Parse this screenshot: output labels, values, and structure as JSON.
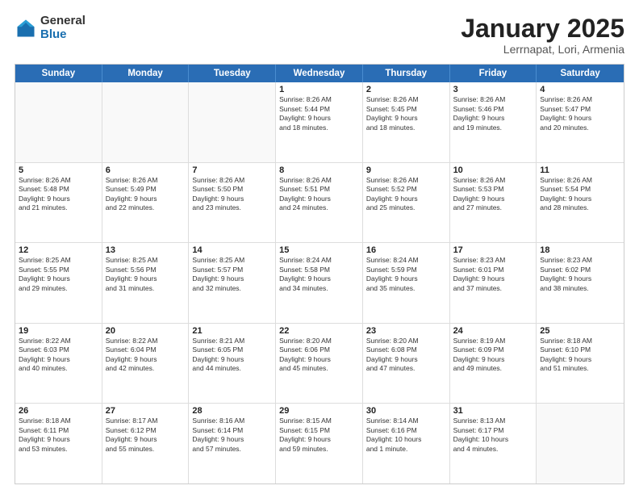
{
  "logo": {
    "general": "General",
    "blue": "Blue"
  },
  "title": "January 2025",
  "subtitle": "Lerrnapat, Lori, Armenia",
  "header_days": [
    "Sunday",
    "Monday",
    "Tuesday",
    "Wednesday",
    "Thursday",
    "Friday",
    "Saturday"
  ],
  "weeks": [
    [
      {
        "day": "",
        "info": "",
        "empty": true
      },
      {
        "day": "",
        "info": "",
        "empty": true
      },
      {
        "day": "",
        "info": "",
        "empty": true
      },
      {
        "day": "1",
        "info": "Sunrise: 8:26 AM\nSunset: 5:44 PM\nDaylight: 9 hours\nand 18 minutes.",
        "empty": false
      },
      {
        "day": "2",
        "info": "Sunrise: 8:26 AM\nSunset: 5:45 PM\nDaylight: 9 hours\nand 18 minutes.",
        "empty": false
      },
      {
        "day": "3",
        "info": "Sunrise: 8:26 AM\nSunset: 5:46 PM\nDaylight: 9 hours\nand 19 minutes.",
        "empty": false
      },
      {
        "day": "4",
        "info": "Sunrise: 8:26 AM\nSunset: 5:47 PM\nDaylight: 9 hours\nand 20 minutes.",
        "empty": false
      }
    ],
    [
      {
        "day": "5",
        "info": "Sunrise: 8:26 AM\nSunset: 5:48 PM\nDaylight: 9 hours\nand 21 minutes.",
        "empty": false
      },
      {
        "day": "6",
        "info": "Sunrise: 8:26 AM\nSunset: 5:49 PM\nDaylight: 9 hours\nand 22 minutes.",
        "empty": false
      },
      {
        "day": "7",
        "info": "Sunrise: 8:26 AM\nSunset: 5:50 PM\nDaylight: 9 hours\nand 23 minutes.",
        "empty": false
      },
      {
        "day": "8",
        "info": "Sunrise: 8:26 AM\nSunset: 5:51 PM\nDaylight: 9 hours\nand 24 minutes.",
        "empty": false
      },
      {
        "day": "9",
        "info": "Sunrise: 8:26 AM\nSunset: 5:52 PM\nDaylight: 9 hours\nand 25 minutes.",
        "empty": false
      },
      {
        "day": "10",
        "info": "Sunrise: 8:26 AM\nSunset: 5:53 PM\nDaylight: 9 hours\nand 27 minutes.",
        "empty": false
      },
      {
        "day": "11",
        "info": "Sunrise: 8:26 AM\nSunset: 5:54 PM\nDaylight: 9 hours\nand 28 minutes.",
        "empty": false
      }
    ],
    [
      {
        "day": "12",
        "info": "Sunrise: 8:25 AM\nSunset: 5:55 PM\nDaylight: 9 hours\nand 29 minutes.",
        "empty": false
      },
      {
        "day": "13",
        "info": "Sunrise: 8:25 AM\nSunset: 5:56 PM\nDaylight: 9 hours\nand 31 minutes.",
        "empty": false
      },
      {
        "day": "14",
        "info": "Sunrise: 8:25 AM\nSunset: 5:57 PM\nDaylight: 9 hours\nand 32 minutes.",
        "empty": false
      },
      {
        "day": "15",
        "info": "Sunrise: 8:24 AM\nSunset: 5:58 PM\nDaylight: 9 hours\nand 34 minutes.",
        "empty": false
      },
      {
        "day": "16",
        "info": "Sunrise: 8:24 AM\nSunset: 5:59 PM\nDaylight: 9 hours\nand 35 minutes.",
        "empty": false
      },
      {
        "day": "17",
        "info": "Sunrise: 8:23 AM\nSunset: 6:01 PM\nDaylight: 9 hours\nand 37 minutes.",
        "empty": false
      },
      {
        "day": "18",
        "info": "Sunrise: 8:23 AM\nSunset: 6:02 PM\nDaylight: 9 hours\nand 38 minutes.",
        "empty": false
      }
    ],
    [
      {
        "day": "19",
        "info": "Sunrise: 8:22 AM\nSunset: 6:03 PM\nDaylight: 9 hours\nand 40 minutes.",
        "empty": false
      },
      {
        "day": "20",
        "info": "Sunrise: 8:22 AM\nSunset: 6:04 PM\nDaylight: 9 hours\nand 42 minutes.",
        "empty": false
      },
      {
        "day": "21",
        "info": "Sunrise: 8:21 AM\nSunset: 6:05 PM\nDaylight: 9 hours\nand 44 minutes.",
        "empty": false
      },
      {
        "day": "22",
        "info": "Sunrise: 8:20 AM\nSunset: 6:06 PM\nDaylight: 9 hours\nand 45 minutes.",
        "empty": false
      },
      {
        "day": "23",
        "info": "Sunrise: 8:20 AM\nSunset: 6:08 PM\nDaylight: 9 hours\nand 47 minutes.",
        "empty": false
      },
      {
        "day": "24",
        "info": "Sunrise: 8:19 AM\nSunset: 6:09 PM\nDaylight: 9 hours\nand 49 minutes.",
        "empty": false
      },
      {
        "day": "25",
        "info": "Sunrise: 8:18 AM\nSunset: 6:10 PM\nDaylight: 9 hours\nand 51 minutes.",
        "empty": false
      }
    ],
    [
      {
        "day": "26",
        "info": "Sunrise: 8:18 AM\nSunset: 6:11 PM\nDaylight: 9 hours\nand 53 minutes.",
        "empty": false
      },
      {
        "day": "27",
        "info": "Sunrise: 8:17 AM\nSunset: 6:12 PM\nDaylight: 9 hours\nand 55 minutes.",
        "empty": false
      },
      {
        "day": "28",
        "info": "Sunrise: 8:16 AM\nSunset: 6:14 PM\nDaylight: 9 hours\nand 57 minutes.",
        "empty": false
      },
      {
        "day": "29",
        "info": "Sunrise: 8:15 AM\nSunset: 6:15 PM\nDaylight: 9 hours\nand 59 minutes.",
        "empty": false
      },
      {
        "day": "30",
        "info": "Sunrise: 8:14 AM\nSunset: 6:16 PM\nDaylight: 10 hours\nand 1 minute.",
        "empty": false
      },
      {
        "day": "31",
        "info": "Sunrise: 8:13 AM\nSunset: 6:17 PM\nDaylight: 10 hours\nand 4 minutes.",
        "empty": false
      },
      {
        "day": "",
        "info": "",
        "empty": true
      }
    ]
  ]
}
